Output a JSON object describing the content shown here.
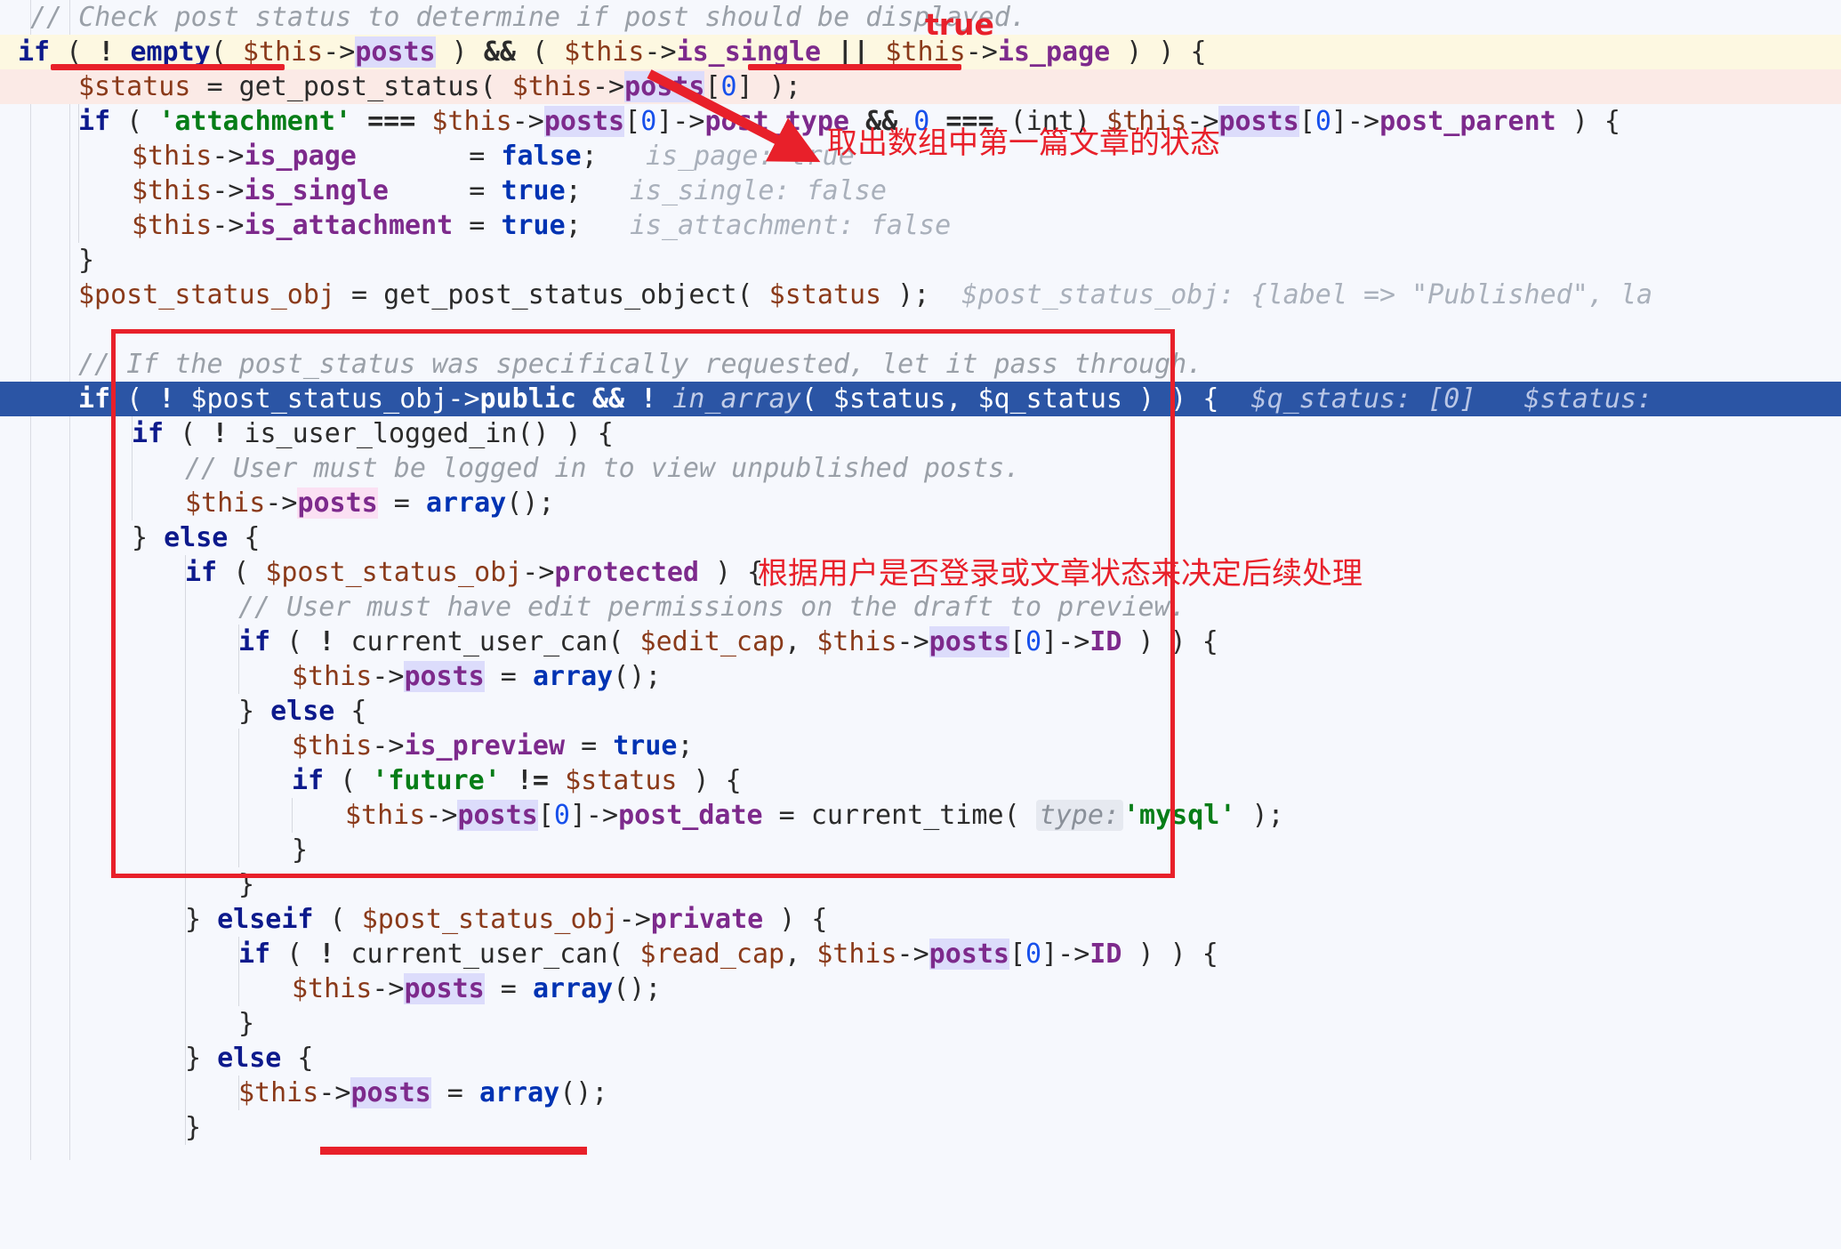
{
  "app": {
    "kind": "code-editor",
    "language": "php",
    "background": "#f6f8fd",
    "accent_red": "#e8202a",
    "selection_line_color": "#2b55a5"
  },
  "lines": [
    {
      "id": "l1",
      "indent": 1,
      "highlight": "none",
      "text": "// Check post status to determine if post should be displayed."
    },
    {
      "id": "l2",
      "indent": 1,
      "highlight": "yellow",
      "text": "if ( ! empty( $this->posts ) && ( $this->is_single || $this->is_page ) ) {"
    },
    {
      "id": "l3",
      "indent": 2,
      "highlight": "pink",
      "text": "$status = get_post_status( $this->posts[0] );"
    },
    {
      "id": "l4",
      "indent": 2,
      "highlight": "none",
      "text": "if ( 'attachment' === $this->posts[0]->post_type && 0 === (int) $this->posts[0]->post_parent ) {"
    },
    {
      "id": "l5",
      "indent": 3,
      "highlight": "none",
      "text": "$this->is_page       = false;",
      "hint": "is_page: true"
    },
    {
      "id": "l6",
      "indent": 3,
      "highlight": "none",
      "text": "$this->is_single     = true;",
      "hint": "is_single: false"
    },
    {
      "id": "l7",
      "indent": 3,
      "highlight": "none",
      "text": "$this->is_attachment = true;",
      "hint": "is_attachment: false"
    },
    {
      "id": "l8",
      "indent": 2,
      "highlight": "none",
      "text": "}"
    },
    {
      "id": "l9",
      "indent": 2,
      "highlight": "none",
      "text": "$post_status_obj = get_post_status_object( $status );",
      "hint": "$post_status_obj: {label => \"Published\", la"
    },
    {
      "id": "l10",
      "indent": 1,
      "highlight": "none",
      "text": ""
    },
    {
      "id": "l11",
      "indent": 2,
      "highlight": "none",
      "text": "// If the post_status was specifically requested, let it pass through."
    },
    {
      "id": "l12",
      "indent": 2,
      "highlight": "blue",
      "text": "if ( ! $post_status_obj->public && ! in_array( $status, $q_status ) ) {",
      "hint": "$q_status: [0]   $status:"
    },
    {
      "id": "l13",
      "indent": 3,
      "highlight": "none",
      "text": "if ( ! is_user_logged_in() ) {"
    },
    {
      "id": "l14",
      "indent": 4,
      "highlight": "none",
      "text": "// User must be logged in to view unpublished posts."
    },
    {
      "id": "l15",
      "indent": 4,
      "highlight": "none",
      "text": "$this->posts = array();"
    },
    {
      "id": "l16",
      "indent": 3,
      "highlight": "none",
      "text": "} else {"
    },
    {
      "id": "l17",
      "indent": 4,
      "highlight": "none",
      "text": "if ( $post_status_obj->protected ) {"
    },
    {
      "id": "l18",
      "indent": 5,
      "highlight": "none",
      "text": "// User must have edit permissions on the draft to preview."
    },
    {
      "id": "l19",
      "indent": 5,
      "highlight": "none",
      "text": "if ( ! current_user_can( $edit_cap, $this->posts[0]->ID ) ) {"
    },
    {
      "id": "l20",
      "indent": 6,
      "highlight": "none",
      "text": "$this->posts = array();"
    },
    {
      "id": "l21",
      "indent": 5,
      "highlight": "none",
      "text": "} else {"
    },
    {
      "id": "l22",
      "indent": 6,
      "highlight": "none",
      "text": "$this->is_preview = true;"
    },
    {
      "id": "l23",
      "indent": 6,
      "highlight": "none",
      "text": "if ( 'future' != $status ) {"
    },
    {
      "id": "l24",
      "indent": 7,
      "highlight": "none",
      "text": "$this->posts[0]->post_date = current_time(  type: 'mysql' );"
    },
    {
      "id": "l25",
      "indent": 6,
      "highlight": "none",
      "text": "}"
    },
    {
      "id": "l26",
      "indent": 5,
      "highlight": "none",
      "text": "}"
    },
    {
      "id": "l27",
      "indent": 4,
      "highlight": "none",
      "text": "} elseif ( $post_status_obj->private ) {"
    },
    {
      "id": "l28",
      "indent": 5,
      "highlight": "none",
      "text": "if ( ! current_user_can( $read_cap, $this->posts[0]->ID ) ) {"
    },
    {
      "id": "l29",
      "indent": 6,
      "highlight": "none",
      "text": "$this->posts = array();"
    },
    {
      "id": "l30",
      "indent": 5,
      "highlight": "none",
      "text": "}"
    },
    {
      "id": "l31",
      "indent": 4,
      "highlight": "none",
      "text": "} else {"
    },
    {
      "id": "l32",
      "indent": 5,
      "highlight": "none",
      "text": "$this->posts = array();"
    },
    {
      "id": "l33",
      "indent": 4,
      "highlight": "none",
      "text": "}"
    }
  ],
  "inline_hints": {
    "is_page": "is_page: true",
    "is_single": "is_single: false",
    "is_attachment": "is_attachment: false",
    "post_status_obj": "$post_status_obj: {label => \"Published\", la",
    "q_status": "$q_status: [0]",
    "status": "$status:",
    "param_type_chip": "type:"
  },
  "annotations": {
    "value_true": "true",
    "note_arrow": "取出数组中第一篇文章的状态",
    "note_box": "根据用户是否登录或文章状态来决定后续处理"
  }
}
